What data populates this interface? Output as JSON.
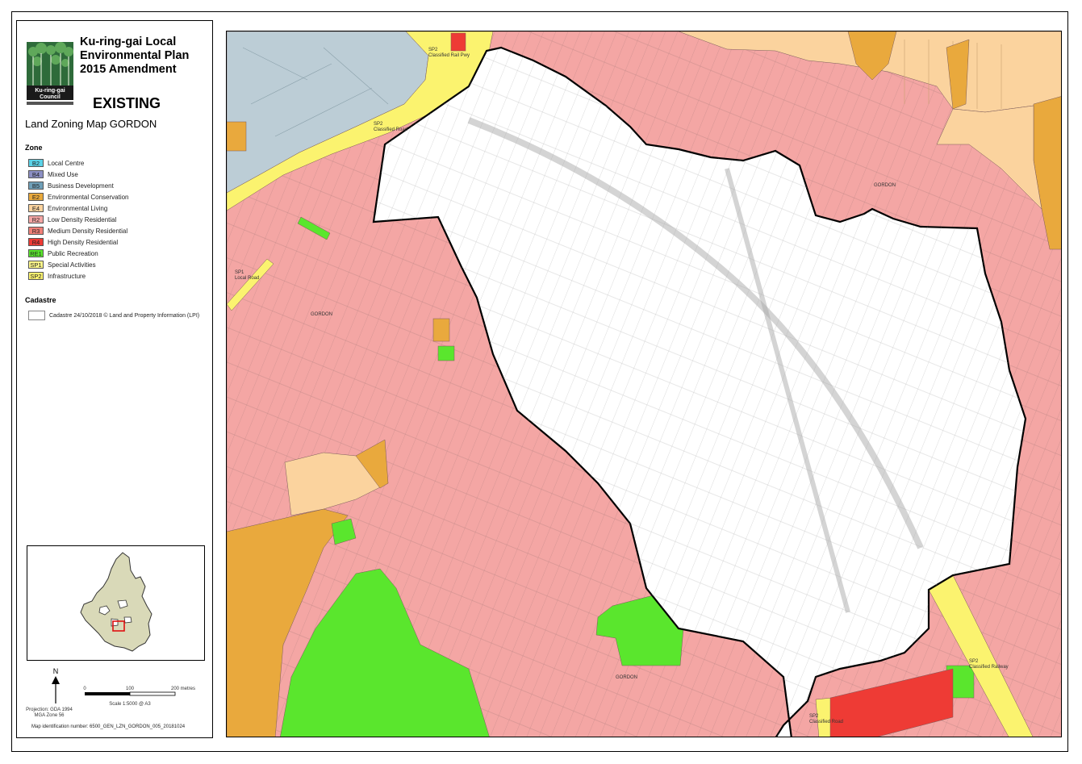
{
  "title": {
    "line1": "Ku-ring-gai Local",
    "line2": "Environmental Plan",
    "line3": "2015 Amendment",
    "status": "EXISTING"
  },
  "logo": {
    "text1": "Ku-ring-gai",
    "text2": "Council",
    "icon": "tree-logo-icon"
  },
  "map_title": "Land Zoning Map GORDON",
  "zone_heading": "Zone",
  "zones": [
    {
      "code": "B2",
      "label": "Local Centre",
      "color": "#5ad2e8"
    },
    {
      "code": "B4",
      "label": "Mixed Use",
      "color": "#8b8fc3"
    },
    {
      "code": "B5",
      "label": "Business Development",
      "color": "#6f9fb8"
    },
    {
      "code": "E2",
      "label": "Environmental Conservation",
      "color": "#e9a93d"
    },
    {
      "code": "E4",
      "label": "Environmental Living",
      "color": "#fbd39e"
    },
    {
      "code": "R2",
      "label": "Low Density Residential",
      "color": "#f4a6a4"
    },
    {
      "code": "R3",
      "label": "Medium Density Residential",
      "color": "#f08078"
    },
    {
      "code": "R4",
      "label": "High Density Residential",
      "color": "#ee3b35"
    },
    {
      "code": "RE1",
      "label": "Public Recreation",
      "color": "#5ae62d"
    },
    {
      "code": "SP1",
      "label": "Special Activities",
      "color": "#fbf58a"
    },
    {
      "code": "SP2",
      "label": "Infrastructure",
      "color": "#fbf36f"
    }
  ],
  "cadastre_heading": "Cadastre",
  "cadastre_label": "Cadastre 24/10/2018 © Land and Property Information (LPI)",
  "scale": {
    "north": "N",
    "ticks": [
      "0",
      "100",
      "200 metres"
    ],
    "text": "Scale   1:5000   @ A3",
    "projection_line1": "Projection: GDA 1994",
    "projection_line2": "MGA Zone 56"
  },
  "map_id": "Map identification number: 6500_GEN_LZN_GORDON_005_20181024",
  "map_labels": {
    "sp2_rail_top": "SP2",
    "sp2_rail_top_sub": "Classified Rail Pwy",
    "sp2_road": "SP2",
    "sp2_road_sub": "Classified Road",
    "sp1": "SP1",
    "sp1_sub": "Local Road",
    "gordon_west": "GORDON",
    "gordon_east": "GORDON",
    "gordon_south": "GORDON",
    "sp2_rail_bottom": "SP2",
    "sp2_rail_bottom_sub": "Classified Railway",
    "sp2_road_bottom": "SP2",
    "sp2_road_bottom_sub": "Classified Road"
  },
  "colors": {
    "r2": "#f4a6a4",
    "e2": "#e9a93d",
    "e4": "#fbd39e",
    "b5": "#bccdd6",
    "re1": "#5ae62d",
    "r4": "#ee3b35",
    "sp2": "#fbf36f",
    "locator_fill": "#d9d9b8"
  }
}
